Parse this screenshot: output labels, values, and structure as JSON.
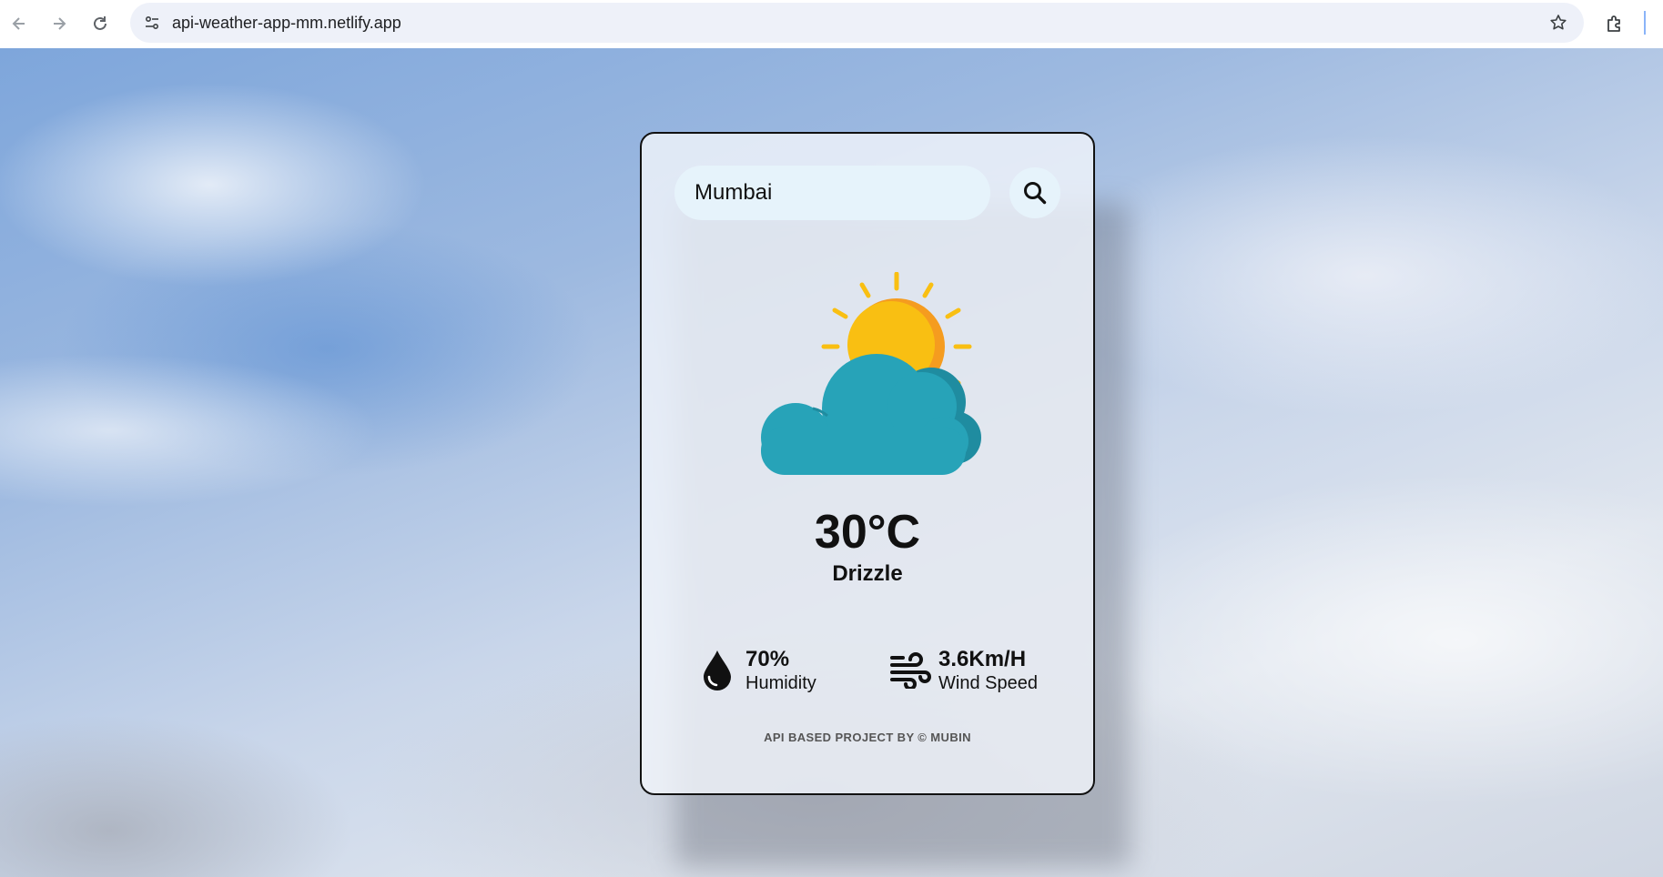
{
  "browser": {
    "url": "api-weather-app-mm.netlify.app"
  },
  "search": {
    "value": "Mumbai"
  },
  "weather": {
    "temperature": "30°C",
    "condition": "Drizzle",
    "icon": "sun-behind-cloud-icon"
  },
  "details": {
    "humidity_value": "70%",
    "humidity_label": "Humidity",
    "wind_value": "3.6Km/H",
    "wind_label": "Wind Speed"
  },
  "footer": {
    "credit": "API BASED PROJECT BY © MUBIN"
  },
  "colors": {
    "cloud": "#27a3b8",
    "cloud_dark": "#1f8ca0",
    "sun": "#f9bf12",
    "sun_shade": "#f59c1f",
    "sun_rays": "#f9bf12",
    "search_bg": "#e6f3fb"
  }
}
